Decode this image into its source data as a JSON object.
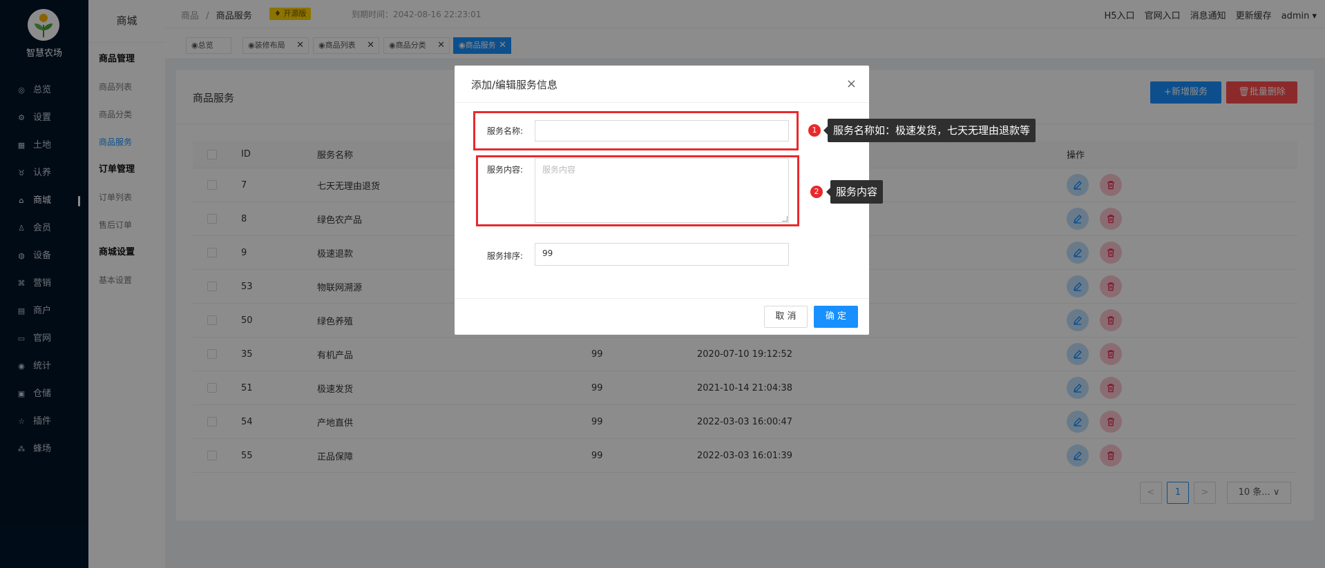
{
  "sidebar": {
    "brand": "智慧农场",
    "items": [
      {
        "icon": "dashboard-icon",
        "glyph": "◎",
        "label": "总览"
      },
      {
        "icon": "settings-icon",
        "glyph": "⚙",
        "label": "设置"
      },
      {
        "icon": "land-icon",
        "glyph": "▦",
        "label": "土地"
      },
      {
        "icon": "adopt-icon",
        "glyph": "♉",
        "label": "认养"
      },
      {
        "icon": "shop-icon",
        "glyph": "⌂",
        "label": "商城",
        "active": true
      },
      {
        "icon": "member-icon",
        "glyph": "♙",
        "label": "会员"
      },
      {
        "icon": "device-icon",
        "glyph": "◍",
        "label": "设备"
      },
      {
        "icon": "marketing-icon",
        "glyph": "⌘",
        "label": "营销"
      },
      {
        "icon": "merchant-icon",
        "glyph": "▤",
        "label": "商户"
      },
      {
        "icon": "website-icon",
        "glyph": "▭",
        "label": "官网"
      },
      {
        "icon": "stats-icon",
        "glyph": "◉",
        "label": "统计"
      },
      {
        "icon": "warehouse-icon",
        "glyph": "▣",
        "label": "仓储"
      },
      {
        "icon": "plugin-icon",
        "glyph": "☆",
        "label": "插件"
      },
      {
        "icon": "apiary-icon",
        "glyph": "⁂",
        "label": "蜂场"
      }
    ]
  },
  "submenu": {
    "title": "商城",
    "entries": [
      {
        "type": "group",
        "label": "商品管理"
      },
      {
        "type": "item",
        "label": "商品列表"
      },
      {
        "type": "item",
        "label": "商品分类"
      },
      {
        "type": "item",
        "label": "商品服务",
        "active": true
      },
      {
        "type": "group",
        "label": "订单管理"
      },
      {
        "type": "item",
        "label": "订单列表"
      },
      {
        "type": "item",
        "label": "售后订单"
      },
      {
        "type": "group",
        "label": "商城设置"
      },
      {
        "type": "item",
        "label": "基本设置"
      }
    ]
  },
  "header": {
    "crumb_root": "商品",
    "crumb_sep": "/",
    "crumb_current": "商品服务",
    "badge": "开源版",
    "expire": "到期时间：2042-08-16 22:23:01",
    "links": [
      "H5入口",
      "官网入口",
      "消息通知",
      "更新缓存",
      "admin ▾"
    ]
  },
  "tags": [
    {
      "label": "◉总览",
      "closable": false
    },
    {
      "label": "◉装修布局",
      "closable": true
    },
    {
      "label": "◉商品列表",
      "closable": true
    },
    {
      "label": "◉商品分类",
      "closable": true
    },
    {
      "label": "◉商品服务",
      "closable": true,
      "active": true
    }
  ],
  "page": {
    "title": "商品服务",
    "add_button": "+新增服务",
    "batch_delete_button": "🗑批量删除"
  },
  "table": {
    "columns": {
      "id": "ID",
      "name": "服务名称",
      "actions": "操作"
    },
    "rows": [
      {
        "id": "7",
        "name": "七天无理由退货",
        "sort": "",
        "time": ""
      },
      {
        "id": "8",
        "name": "绿色农产品",
        "sort": "",
        "time": ""
      },
      {
        "id": "9",
        "name": "极速退款",
        "sort": "",
        "time": ""
      },
      {
        "id": "53",
        "name": "物联网溯源",
        "sort": "",
        "time": ""
      },
      {
        "id": "50",
        "name": "绿色养殖",
        "sort": "",
        "time": ""
      },
      {
        "id": "35",
        "name": "有机产品",
        "sort": "99",
        "time": "2020-07-10 19:12:52"
      },
      {
        "id": "51",
        "name": "极速发货",
        "sort": "99",
        "time": "2021-10-14 21:04:38"
      },
      {
        "id": "54",
        "name": "产地直供",
        "sort": "99",
        "time": "2022-03-03 16:00:47"
      },
      {
        "id": "55",
        "name": "正品保障",
        "sort": "99",
        "time": "2022-03-03 16:01:39"
      }
    ]
  },
  "pagination": {
    "prev": "<",
    "current": "1",
    "next": ">",
    "page_size": "10 条... ∨"
  },
  "modal": {
    "title": "添加/编辑服务信息",
    "close": "×",
    "name_label": "服务名称:",
    "name_value": "",
    "content_label": "服务内容:",
    "content_placeholder": "服务内容",
    "sort_label": "服务排序:",
    "sort_value": "99",
    "cancel": "取 消",
    "confirm": "确 定"
  },
  "annotations": [
    {
      "num": "1",
      "text": "服务名称如：极速发货，七天无理由退款等"
    },
    {
      "num": "2",
      "text": "服务内容"
    }
  ],
  "colors": {
    "sidebar_bg": "#001529",
    "primary": "#1890ff",
    "danger": "#ff4d4f",
    "annotation_red": "#e8292b",
    "badge_yellow": "#ffd400"
  }
}
